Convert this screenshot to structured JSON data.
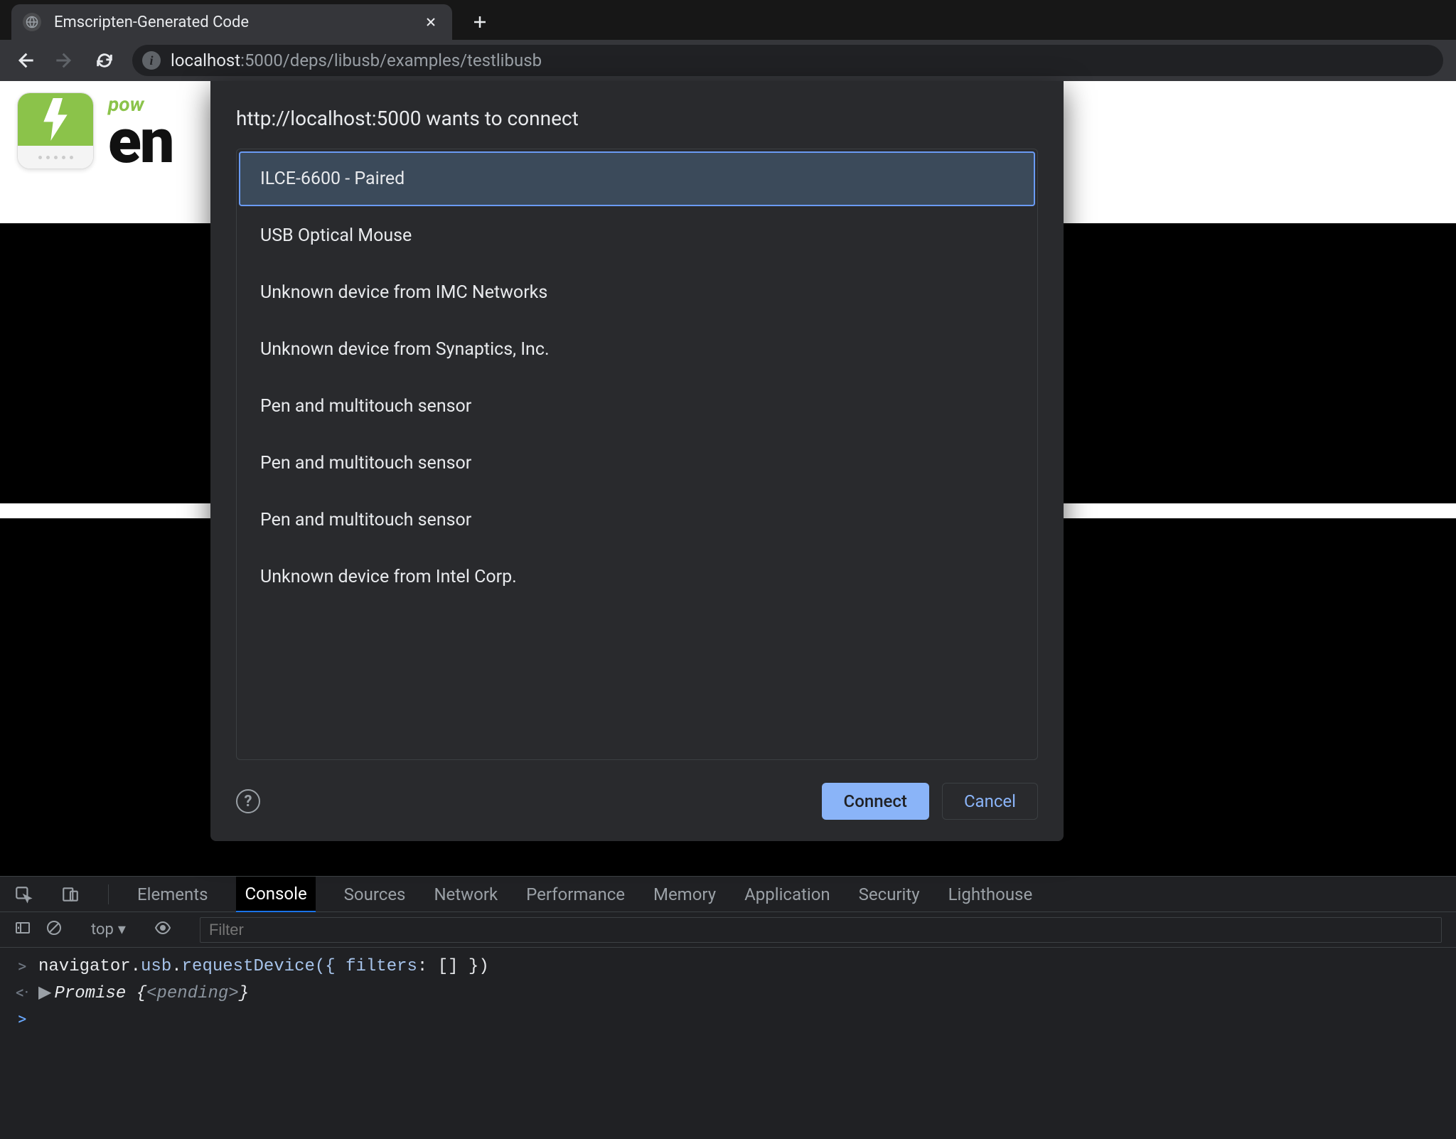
{
  "tab": {
    "title": "Emscripten-Generated Code"
  },
  "url": {
    "host": "localhost",
    "port_path": ":5000/deps/libusb/examples/testlibusb"
  },
  "page": {
    "powered": "pow",
    "em_text": "en"
  },
  "dialog": {
    "title": "http://localhost:5000 wants to connect",
    "devices": [
      "ILCE-6600 - Paired",
      "USB Optical Mouse",
      "Unknown device from IMC Networks",
      "Unknown device from Synaptics, Inc.",
      "Pen and multitouch sensor",
      "Pen and multitouch sensor",
      "Pen and multitouch sensor",
      "Unknown device from Intel Corp."
    ],
    "selected_index": 0,
    "connect": "Connect",
    "cancel": "Cancel"
  },
  "devtools": {
    "tabs": [
      "Elements",
      "Console",
      "Sources",
      "Network",
      "Performance",
      "Memory",
      "Application",
      "Security",
      "Lighthouse"
    ],
    "active_tab_index": 1,
    "context": "top",
    "filter_placeholder": "Filter",
    "console": {
      "input_prefix": ">",
      "output_prefix": "<·",
      "caret": ">",
      "input_line_pre": "navigator.",
      "input_line_prop1": "usb",
      "input_line_dot": ".",
      "input_line_call": "requestDevice({ ",
      "input_line_key": "filters",
      "input_line_post": ": [] })",
      "output_arrow": "▶",
      "output_obj": "Promise ",
      "output_brace_open": "{",
      "output_pending": "<pending>",
      "output_brace_close": "}"
    }
  }
}
